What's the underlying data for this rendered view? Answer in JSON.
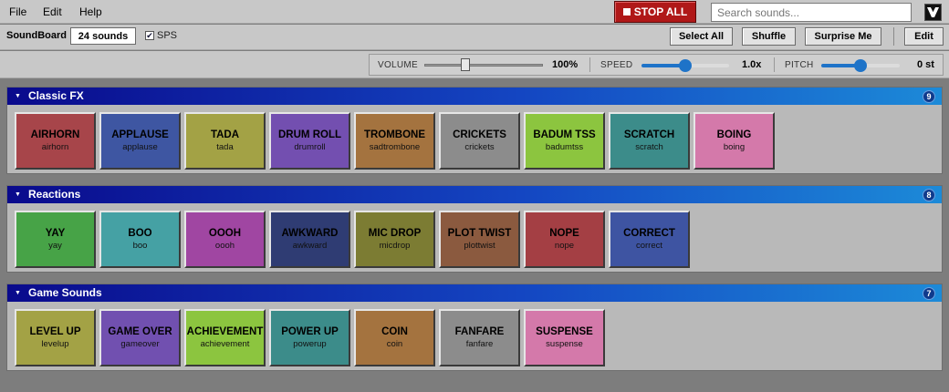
{
  "menu": {
    "items": [
      "File",
      "Edit",
      "Help"
    ]
  },
  "stop_all_label": "STOP ALL",
  "search": {
    "placeholder": "Search sounds...",
    "value": ""
  },
  "toolbar": {
    "app_label": "SoundBoard",
    "count": "24 sounds",
    "sps_label": "SPS",
    "sps_checked_mark": "✔",
    "select_all": "Select All",
    "shuffle": "Shuffle",
    "surprise": "Surprise Me",
    "edit": "Edit"
  },
  "controls": {
    "volume_label": "VOLUME",
    "volume_value": "100%",
    "speed_label": "SPEED",
    "speed_value": "1.0x",
    "speed_level": 0.5,
    "pitch_label": "PITCH",
    "pitch_value": "0 st",
    "pitch_level": 0.5
  },
  "groups": [
    {
      "title": "Classic FX",
      "count": "9",
      "pads": [
        {
          "name": "AIRHORN",
          "key": "airhorn",
          "color": "#a7454a"
        },
        {
          "name": "APPLAUSE",
          "key": "applause",
          "color": "#3e56a2"
        },
        {
          "name": "TADA",
          "key": "tada",
          "color": "#a3a245"
        },
        {
          "name": "DRUM ROLL",
          "key": "drumroll",
          "color": "#734fb0"
        },
        {
          "name": "TROMBONE",
          "key": "sadtrombone",
          "color": "#a4733f"
        },
        {
          "name": "CRICKETS",
          "key": "crickets",
          "color": "#8c8c8c"
        },
        {
          "name": "BADUM TSS",
          "key": "badumtss",
          "color": "#8cc53f"
        },
        {
          "name": "SCRATCH",
          "key": "scratch",
          "color": "#3c8c8a"
        },
        {
          "name": "BOING",
          "key": "boing",
          "color": "#d479aa"
        }
      ]
    },
    {
      "title": "Reactions",
      "count": "8",
      "pads": [
        {
          "name": "YAY",
          "key": "yay",
          "color": "#47a347"
        },
        {
          "name": "BOO",
          "key": "boo",
          "color": "#45a1a4"
        },
        {
          "name": "OOOH",
          "key": "oooh",
          "color": "#a046a2"
        },
        {
          "name": "AWKWARD",
          "key": "awkward",
          "color": "#2f3c73"
        },
        {
          "name": "MIC DROP",
          "key": "micdrop",
          "color": "#7c7c33"
        },
        {
          "name": "PLOT TWIST",
          "key": "plottwist",
          "color": "#8b5a3f"
        },
        {
          "name": "NOPE",
          "key": "nope",
          "color": "#a43f44"
        },
        {
          "name": "CORRECT",
          "key": "correct",
          "color": "#3e54a2"
        }
      ]
    },
    {
      "title": "Game Sounds",
      "count": "7",
      "pads": [
        {
          "name": "LEVEL UP",
          "key": "levelup",
          "color": "#a3a245"
        },
        {
          "name": "GAME OVER",
          "key": "gameover",
          "color": "#7150b0"
        },
        {
          "name": "ACHIEVEMENT",
          "key": "achievement",
          "color": "#8cc53f"
        },
        {
          "name": "POWER UP",
          "key": "powerup",
          "color": "#3c8c8a"
        },
        {
          "name": "COIN",
          "key": "coin",
          "color": "#a4733f"
        },
        {
          "name": "FANFARE",
          "key": "fanfare",
          "color": "#8c8c8c"
        },
        {
          "name": "SUSPENSE",
          "key": "suspense",
          "color": "#d479aa"
        }
      ]
    }
  ]
}
